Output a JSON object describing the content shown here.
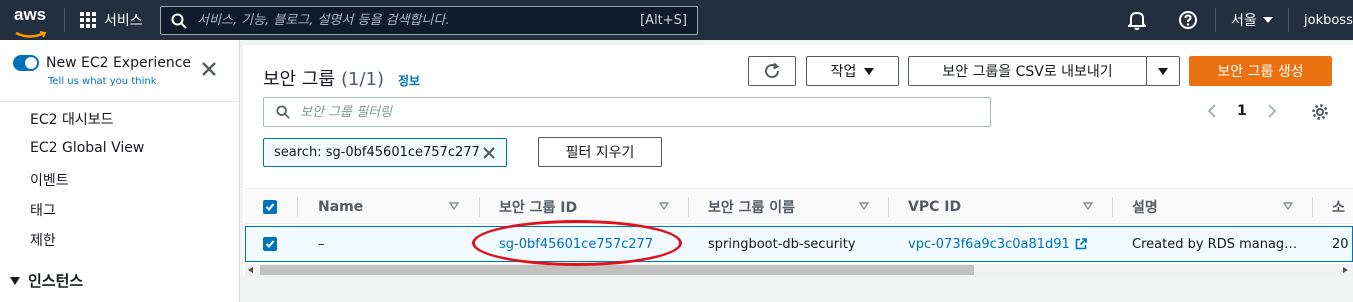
{
  "topnav": {
    "logo_text": "aws",
    "services_label": "서비스",
    "search_placeholder": "서비스, 기능, 블로그, 설명서 등을 검색합니다.",
    "search_shortcut": "[Alt+S]",
    "region": "서울",
    "user": "jokbossa"
  },
  "sidebar": {
    "experience_title": "New EC2 Experience",
    "experience_link": "Tell us what you think",
    "items": [
      "EC2 대시보드",
      "EC2 Global View",
      "이벤트",
      "태그",
      "제한"
    ],
    "section": "인스턴스"
  },
  "main": {
    "title": "보안 그룹",
    "count": "(1/1)",
    "info": "정보",
    "actions_label": "작업",
    "export_label": "보안 그룹을 CSV로 내보내기",
    "create_label": "보안 그룹 생성",
    "filter_placeholder": "보안 그룹 필터링",
    "page": "1",
    "token": "search: sg-0bf45601ce757c277",
    "clear_filters": "필터 지우기"
  },
  "table": {
    "columns": [
      "Name",
      "보안 그룹 ID",
      "보안 그룹 이름",
      "VPC ID",
      "설명",
      "소"
    ],
    "rows": [
      {
        "name": "–",
        "group_id": "sg-0bf45601ce757c277",
        "group_name": "springboot-db-security",
        "vpc_id": "vpc-073f6a9c3c0a81d91",
        "description": "Created by RDS manag…",
        "owner": "20"
      }
    ]
  },
  "colors": {
    "accent": "#0073bb",
    "primary_button": "#ec7211",
    "header": "#232f3e",
    "highlight": "#e0131d"
  }
}
